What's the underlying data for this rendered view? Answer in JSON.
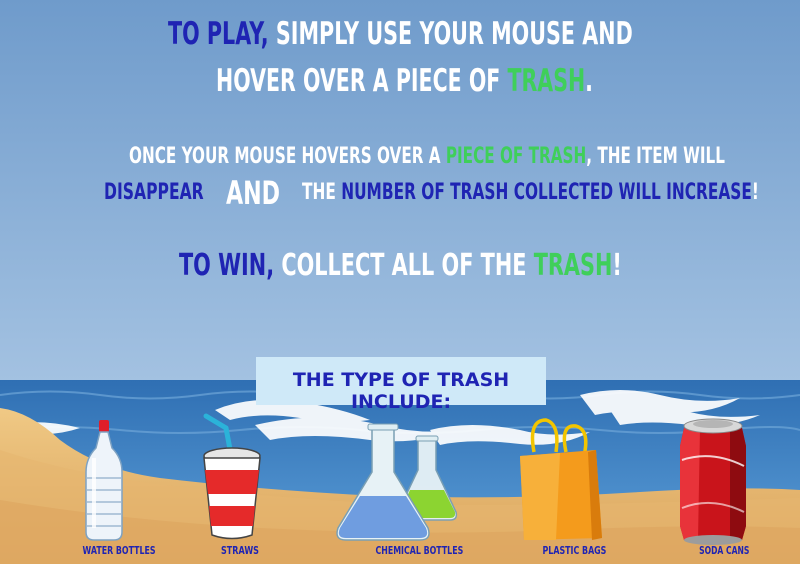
{
  "instructions": {
    "line1": {
      "to_play": "TO PLAY,",
      "rest": " SIMPLY USE YOUR MOUSE AND"
    },
    "line2": {
      "start": "HOVER OVER A PIECE OF ",
      "trash": "TRASH",
      "end": "."
    },
    "line3": {
      "start": "ONCE YOUR MOUSE HOVERS OVER A ",
      "piece": "PIECE OF TRASH",
      "end": ", THE ITEM WILL"
    },
    "line4": {
      "disappear": "DISAPPEAR",
      "and": "AND",
      "the": "THE ",
      "number": "NUMBER OF TRASH COLLECTED WILL INCREASE",
      "excl": "!"
    },
    "line5": {
      "to_win": "TO WIN,",
      "collect": " COLLECT ALL OF THE ",
      "trash": "TRASH",
      "excl": "!"
    }
  },
  "trash_types": {
    "title": "THE TYPE OF TRASH INCLUDE:",
    "items": [
      "WATER BOTTLES",
      "STRAWS",
      "CHEMICAL BOTTLES",
      "PLASTIC BAGS",
      "SODA CANS"
    ]
  },
  "colors": {
    "sky_top": "#6f9bcb",
    "sky_bottom": "#c9dcee",
    "ocean": "#3f7fbf",
    "sand": "#e8b56a",
    "text_blue": "#1f24b3",
    "text_green": "#3fcf5a",
    "text_white": "#ffffff"
  }
}
